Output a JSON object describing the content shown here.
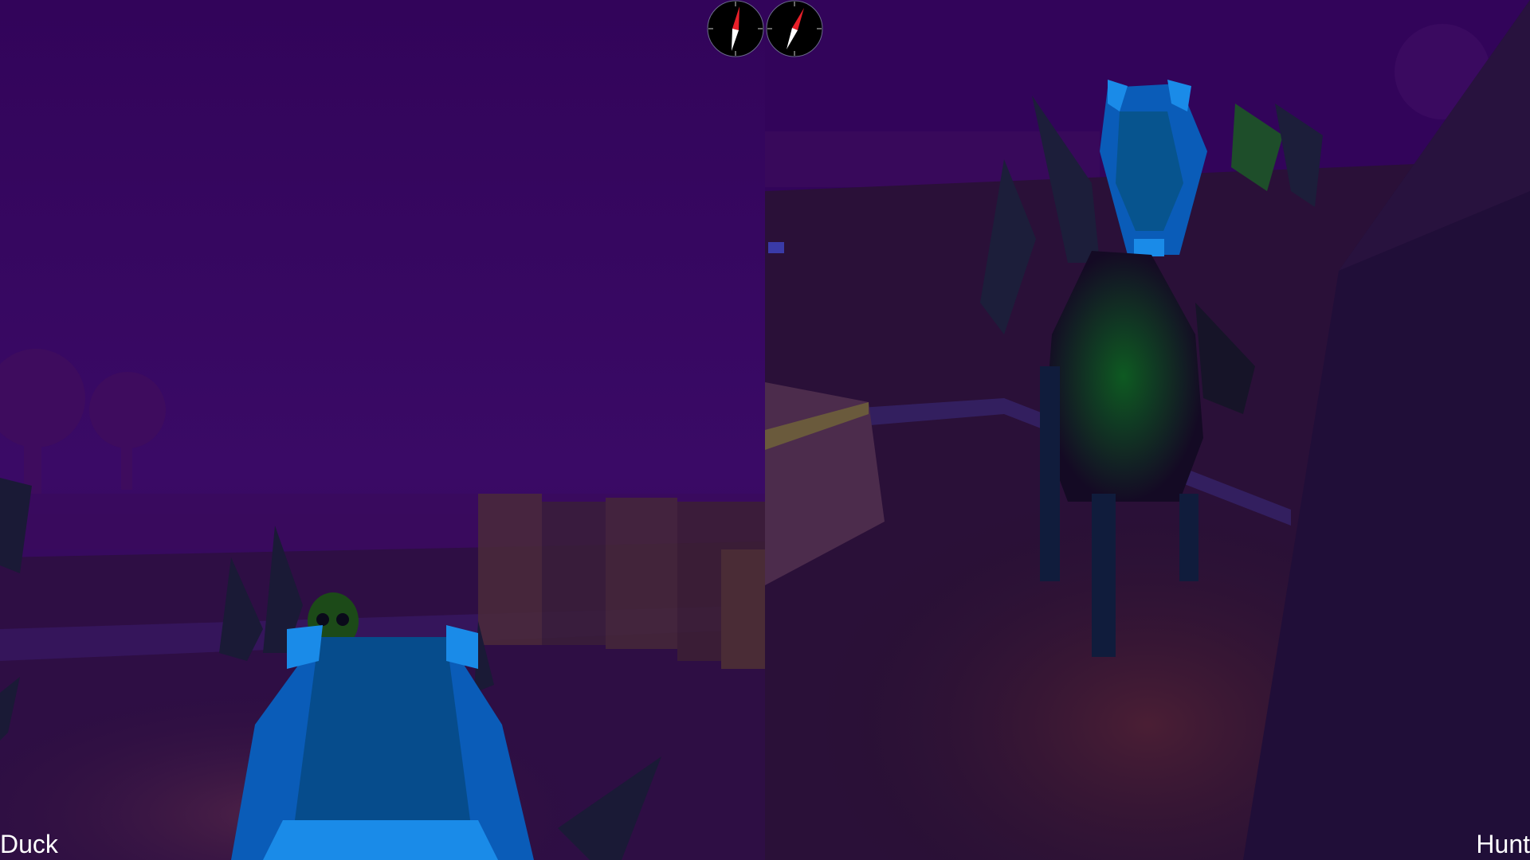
{
  "viewports": {
    "left": {
      "player_label": "Duck"
    },
    "right": {
      "player_label": "Hunt"
    }
  },
  "hud": {
    "compass_count": 2,
    "compass_needle_colors": [
      "#e8202a",
      "#ffffff"
    ]
  },
  "colors": {
    "sky": "#32045a",
    "ground": "#2a0f3c",
    "duck_blue": "#0a66c8",
    "duck_light_blue": "#1a8be8",
    "hunter_body": "#140a24",
    "hunter_glow": "#0e5a22"
  }
}
